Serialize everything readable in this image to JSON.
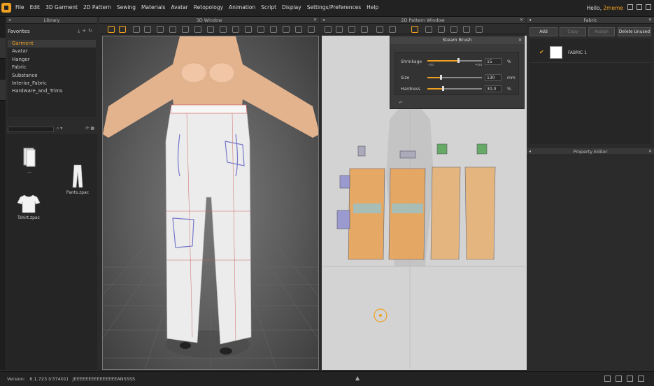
{
  "menubar": {
    "items": [
      "File",
      "Edit",
      "3D Garment",
      "2D Pattern",
      "Sewing",
      "Materials",
      "Avatar",
      "Retopology",
      "Animation",
      "Script",
      "Display",
      "Settings/Preferences",
      "Help"
    ],
    "greeting": "Hello,",
    "username": "2meme"
  },
  "library": {
    "title": "Library",
    "favorites": "Favorites",
    "tree": [
      "Garment",
      "Avatar",
      "Hanger",
      "Fabric",
      "Substance",
      "Interior_Fabric",
      "Hardware_and_Trims"
    ],
    "selected_tree_index": 0,
    "items": [
      {
        "label": "..."
      },
      {
        "label": "Pants.zpac"
      },
      {
        "label": "Tshirt.zpac"
      }
    ]
  },
  "window3d": {
    "title": "3D Window"
  },
  "window2d": {
    "title": "2D Pattern Window"
  },
  "steam_brush": {
    "title": "Steam Brush",
    "rows": [
      {
        "label": "Shrinkage",
        "value": "15",
        "unit": "%",
        "fraction": 0.56,
        "min": "-oo",
        "max": "+oo"
      },
      {
        "label": "Size",
        "value": "130",
        "unit": "mm",
        "fraction": 0.24
      },
      {
        "label": "Hardness",
        "value": "30,0",
        "unit": "%",
        "fraction": 0.28
      }
    ]
  },
  "fabric": {
    "title": "Fabric",
    "buttons": {
      "add": "Add",
      "copy": "Copy",
      "assign": "Assign",
      "delete_unused": "Delete Unused"
    },
    "items": [
      {
        "name": "FABRIC 1",
        "color": "#ffffff"
      }
    ]
  },
  "property_editor": {
    "title": "Property Editor"
  },
  "status": {
    "version_label": "Version:",
    "version": "6.1.723 (r37401)",
    "build": "JEEEEEEEEEEEEEEEANSSSS"
  },
  "colors": {
    "accent": "#f0a020",
    "panel": "#2b2b2b",
    "viewport2d": "#d3d3d3"
  }
}
